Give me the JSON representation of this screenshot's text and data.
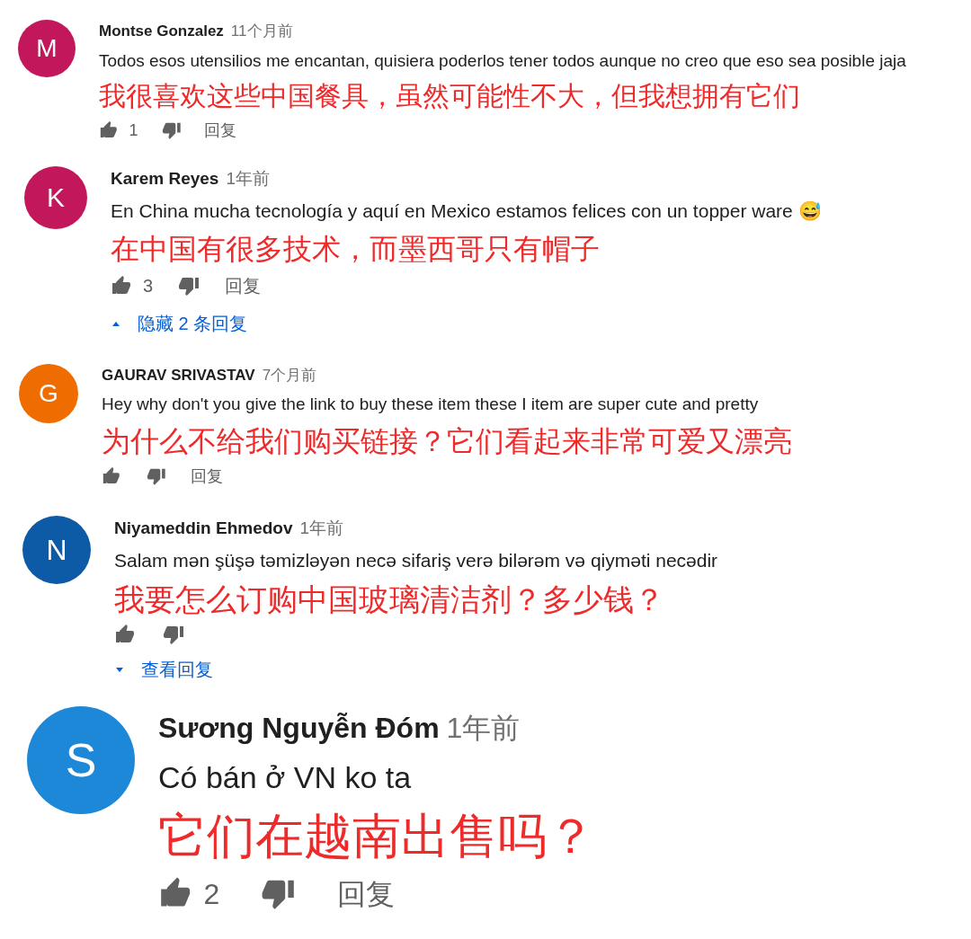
{
  "comments": [
    {
      "avatar_letter": "M",
      "color": "#c2185b",
      "author": "Montse Gonzalez",
      "time": "11个月前",
      "text": "Todos esos utensilios me encantan, quisiera poderlos tener todos aunque no creo que eso sea posible jaja",
      "annotation": "我很喜欢这些中国餐具，虽然可能性不大，但我想拥有它们",
      "likes": "1",
      "reply": "回复"
    },
    {
      "avatar_letter": "K",
      "color": "#c2185b",
      "author": "Karem Reyes",
      "time": "1年前",
      "text": "En China mucha tecnología y aquí en Mexico estamos felices con un topper ware 😅",
      "annotation": "在中国有很多技术，而墨西哥只有帽子",
      "likes": "3",
      "reply": "回复",
      "replies_toggle": {
        "label": "隐藏 2 条回复",
        "expanded": true
      }
    },
    {
      "avatar_letter": "G",
      "color": "#ef6c00",
      "author": "GAURAV SRIVASTAV",
      "time": "7个月前",
      "text": "Hey why don't you give the link to buy these item these I item are super cute and pretty",
      "annotation": "为什么不给我们购买链接？它们看起来非常可爱又漂亮",
      "reply": "回复"
    },
    {
      "avatar_letter": "N",
      "color": "#0d5ba6",
      "author": "Niyameddin Ehmedov",
      "time": "1年前",
      "text": "Salam mən  şüşə təmizləyən necə  sifariş verə bilərəm və qiyməti necədir",
      "annotation": "我要怎么订购中国玻璃清洁剂？多少钱？",
      "replies_toggle": {
        "label": "查看回复",
        "expanded": false
      }
    },
    {
      "avatar_letter": "S",
      "color": "#1e88d8",
      "author": "Sương Nguyễn Đóm",
      "time": "1年前",
      "text": "Có bán ở VN ko ta",
      "annotation": "它们在越南出售吗？",
      "likes": "2",
      "reply": "回复"
    }
  ]
}
